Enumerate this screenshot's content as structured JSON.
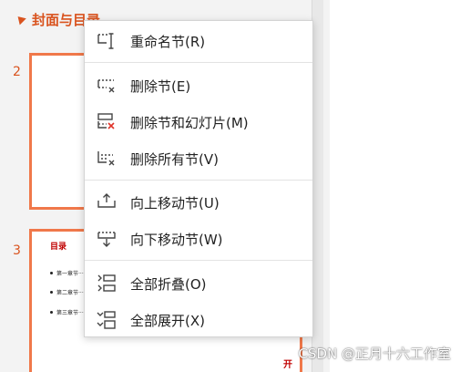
{
  "thumbnail_panel": {
    "section_title": "封面与目录",
    "slides": [
      {
        "number": "2"
      },
      {
        "number": "3",
        "title": "目录",
        "bullets": [
          "第一章节·····",
          "第二章节·····",
          "第三章节·····"
        ],
        "partial_char": "开"
      }
    ]
  },
  "context_menu": {
    "items": [
      {
        "label": "重命名节(R)",
        "icon": "rename-section-icon"
      },
      {
        "label": "删除节(E)",
        "icon": "delete-section-icon"
      },
      {
        "label": "删除节和幻灯片(M)",
        "icon": "delete-section-and-slides-icon"
      },
      {
        "label": "删除所有节(V)",
        "icon": "delete-all-sections-icon"
      },
      {
        "label": "向上移动节(U)",
        "icon": "move-section-up-icon"
      },
      {
        "label": "向下移动节(W)",
        "icon": "move-section-down-icon"
      },
      {
        "label": "全部折叠(O)",
        "icon": "collapse-all-icon"
      },
      {
        "label": "全部展开(X)",
        "icon": "expand-all-icon"
      }
    ]
  },
  "watermark": "CSDN @正月十六工作室",
  "colors": {
    "accent": "#d9531e",
    "slide_border": "#f0784a",
    "slide_title": "#c00000",
    "icon": "#444444",
    "icon_alert": "#e0342a"
  }
}
